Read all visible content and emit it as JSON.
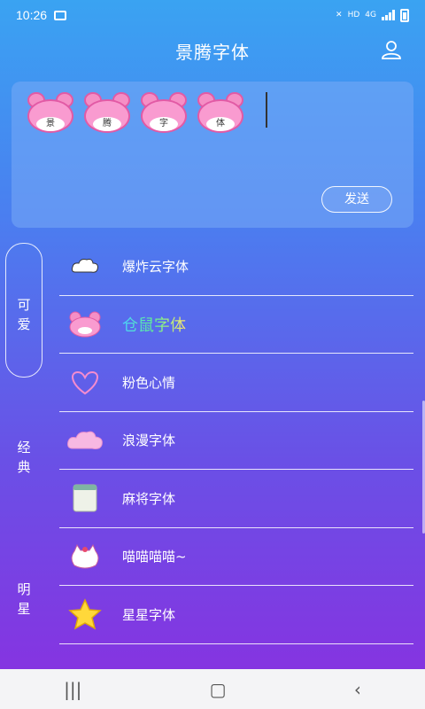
{
  "status_bar": {
    "time": "10:26",
    "network": "HD",
    "signal": "4G"
  },
  "header": {
    "title": "景腾字体"
  },
  "input": {
    "preview_chars": [
      "景",
      "腾",
      "字",
      "体"
    ],
    "send_label": "发送"
  },
  "categories": [
    {
      "label": "可\n爱",
      "active": true
    },
    {
      "label": "经\n典",
      "active": false
    },
    {
      "label": "明\n星",
      "active": false
    }
  ],
  "fonts": [
    {
      "name": "爆炸云字体",
      "icon": "cloud-icon"
    },
    {
      "name": "仓鼠字体",
      "icon": "hamster-icon"
    },
    {
      "name": "粉色心情",
      "icon": "heart-icon"
    },
    {
      "name": "浪漫字体",
      "icon": "pink-cloud-icon"
    },
    {
      "name": "麻将字体",
      "icon": "mahjong-tile-icon"
    },
    {
      "name": "喵喵喵喵~",
      "icon": "cat-icon"
    },
    {
      "name": "星星字体",
      "icon": "star-icon"
    }
  ]
}
